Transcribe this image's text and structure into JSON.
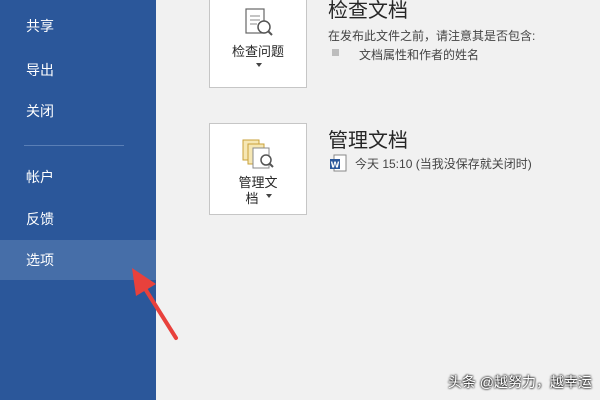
{
  "sidebar": {
    "items": [
      {
        "label": "共享"
      },
      {
        "label": "导出"
      },
      {
        "label": "关闭"
      },
      {
        "label": "帐户"
      },
      {
        "label": "反馈"
      },
      {
        "label": "选项",
        "selected": true
      }
    ]
  },
  "inspect": {
    "title": "检查文档",
    "description": "在发布此文件之前，请注意其是否包含:",
    "bullet": "文档属性和作者的姓名",
    "button_label": "检查问题"
  },
  "manage": {
    "title": "管理文档",
    "version_entry": "今天 15:10 (当我没保存就关闭时)",
    "button_label_line1": "管理文",
    "button_label_line2": "档"
  },
  "watermark": "头条 @越努力，越幸运",
  "colors": {
    "sidebar_bg": "#2b579a",
    "sidebar_selected": "#466ea8",
    "main_bg": "#f1f1f1",
    "arrow": "#e8413c"
  },
  "icons": {
    "inspect": "document-inspect-icon",
    "manage": "manage-document-icon",
    "version": "word-document-icon",
    "annotation": "red-arrow-icon"
  }
}
